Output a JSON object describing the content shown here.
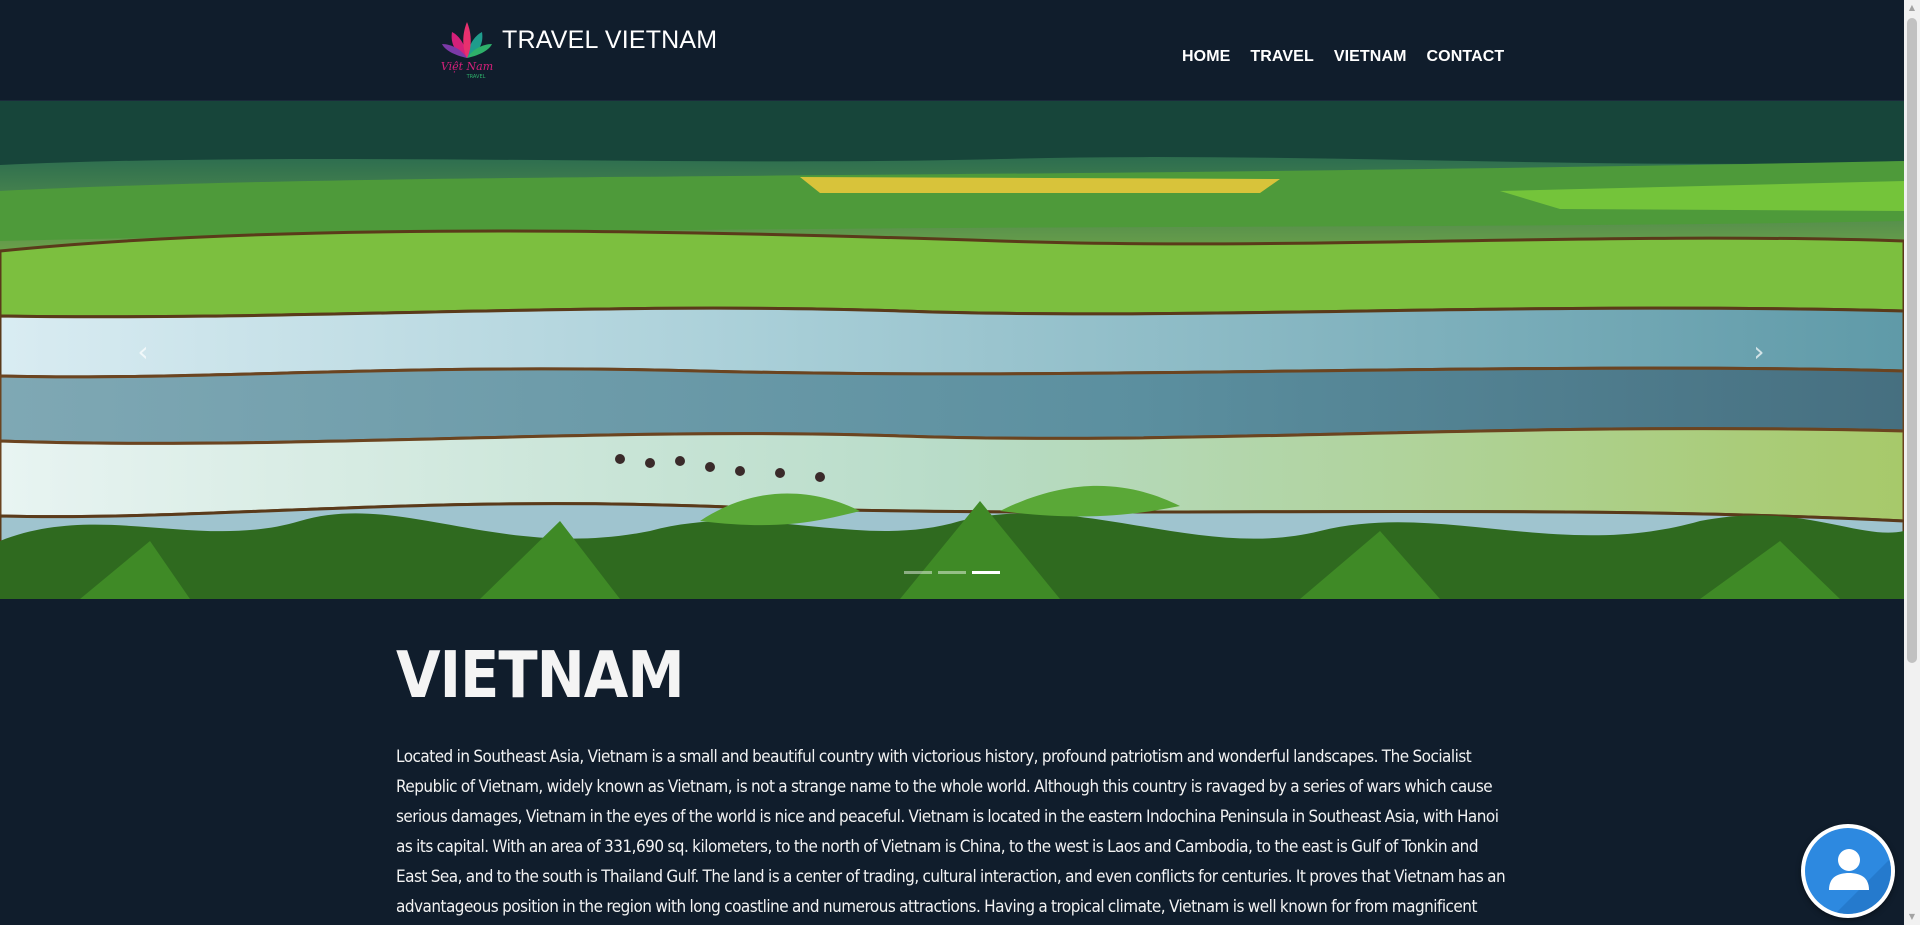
{
  "brand": {
    "title": "TRAVEL VIETNAM",
    "logo_text": "Việt Nam",
    "logo_subtext": "TRAVEL"
  },
  "nav": {
    "items": [
      {
        "label": "HOME"
      },
      {
        "label": "TRAVEL"
      },
      {
        "label": "VIETNAM"
      },
      {
        "label": "CONTACT"
      }
    ]
  },
  "carousel": {
    "prev_icon": "chevron-left-icon",
    "next_icon": "chevron-right-icon",
    "slide_count": 3,
    "active_index": 2
  },
  "main": {
    "title": "VIETNAM",
    "intro": "Located in Southeast Asia, Vietnam is a small and beautiful country with victorious history, profound patriotism and wonderful landscapes. The Socialist Republic of Vietnam, widely known as Vietnam, is not a strange name to the whole world. Although this country is ravaged by a series of wars which cause serious damages, Vietnam in the eyes of the world is nice and peaceful. Vietnam is located in the eastern Indochina Peninsula in Southeast Asia, with Hanoi as its capital. With an area of 331,690 sq. kilometers, to the north of Vietnam is China, to the west is Laos and Cambodia, to the east is Gulf of Tonkin and East Sea, and to the south is Thailand Gulf. The land is a center of trading, cultural interaction, and even conflicts for centuries. It proves that Vietnam has an advantageous position in the region with long coastline and numerous attractions. Having a tropical climate, Vietnam is well known for from magnificent"
  },
  "chat": {
    "icon": "user-avatar-icon"
  },
  "colors": {
    "background": "#101d2c",
    "text": "#ffffff",
    "chat_accent": "#2d89e0"
  }
}
